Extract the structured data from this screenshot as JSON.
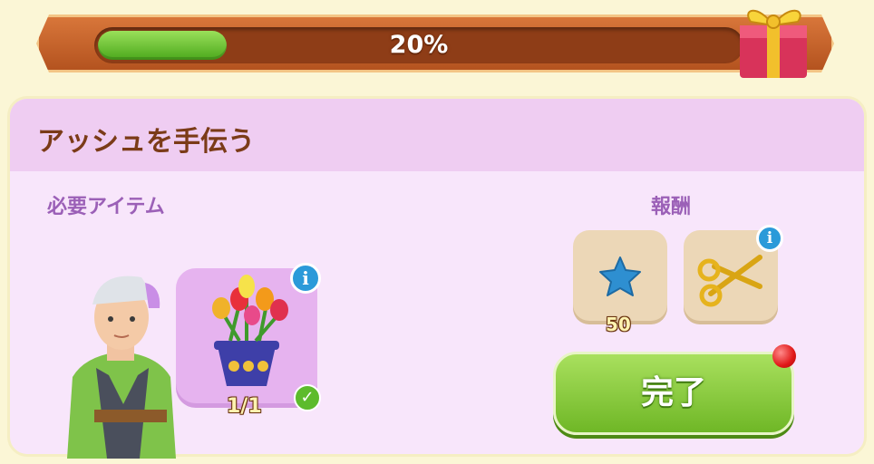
{
  "progress": {
    "label": "20%",
    "value": 0.2
  },
  "panel": {
    "title": "アッシュを手伝う",
    "required_label": "必要アイテム",
    "reward_label": "報酬"
  },
  "required_item": {
    "name_icon": "tulip-pot-icon",
    "count": "1/1",
    "completed": true
  },
  "rewards": [
    {
      "icon": "blue-star-icon",
      "amount": "50"
    },
    {
      "icon": "golden-scissors-icon",
      "amount": ""
    }
  ],
  "complete_button": {
    "label": "完了"
  },
  "colors": {
    "accent_green": "#6fb726",
    "title_brown": "#7b3b18",
    "label_purple": "#9b60b7"
  }
}
